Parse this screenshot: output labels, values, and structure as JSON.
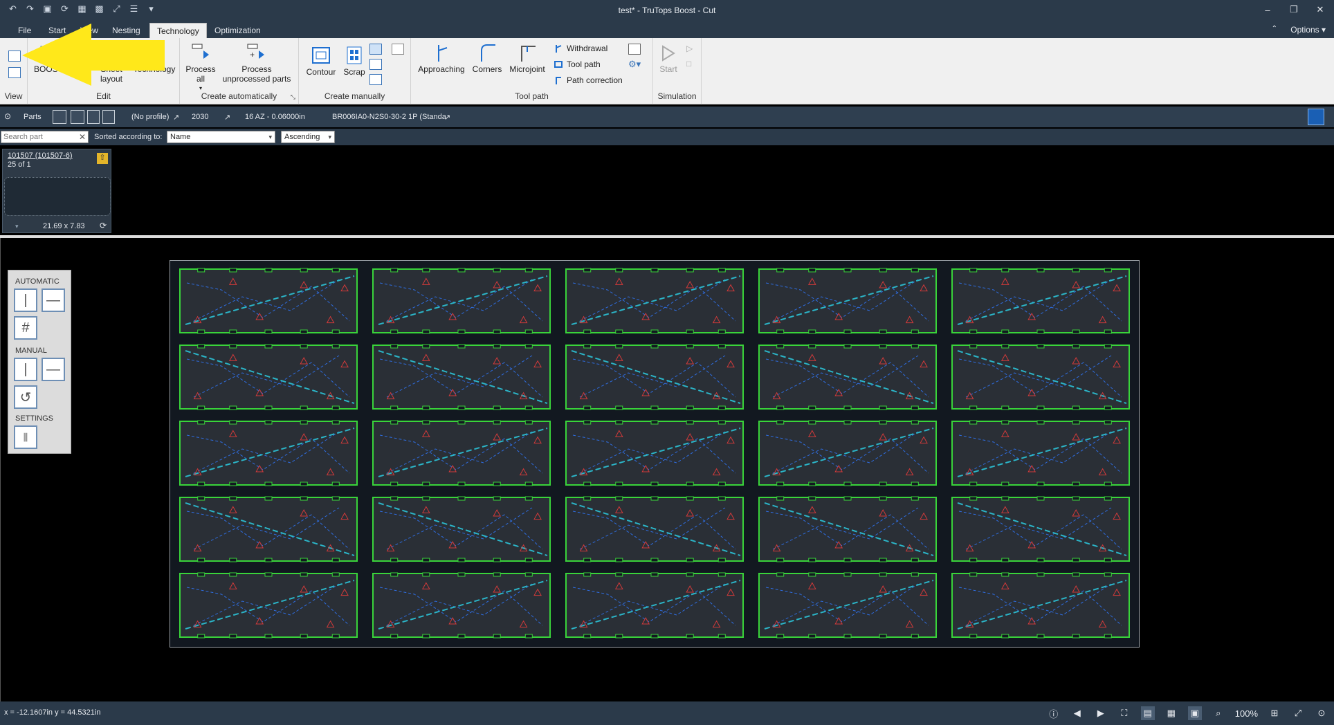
{
  "window": {
    "title": "test* - TruTops Boost - Cut"
  },
  "quick_access": [
    "undo-icon",
    "redo-icon",
    "save-icon",
    "refresh-icon",
    "grid-icon",
    "grid-alt-icon",
    "resize-icon",
    "toolbar-icon"
  ],
  "menu": {
    "tabs": [
      "File",
      "Start",
      "View",
      "Nesting",
      "Technology",
      "Optimization"
    ],
    "active_tab": "Technology",
    "options_label": "Options"
  },
  "ribbon": {
    "view": {
      "group_label": "View"
    },
    "edit": {
      "group_label": "Edit",
      "boost_label": "BOOST",
      "sheet_layout_label": "Sheet layout",
      "technology_label": "Technology"
    },
    "create_auto": {
      "group_label": "Create automatically",
      "process_all_label": "Process all",
      "process_unprocessed_label": "Process unprocessed parts"
    },
    "create_manual": {
      "group_label": "Create manually",
      "contour_label": "Contour",
      "scrap_label": "Scrap"
    },
    "tool_path": {
      "group_label": "Tool path",
      "approaching_label": "Approaching",
      "corners_label": "Corners",
      "microjoint_label": "Microjoint",
      "withdrawal_label": "Withdrawal",
      "tool_path_label": "Tool path",
      "path_correction_label": "Path correction"
    },
    "simulation": {
      "group_label": "Simulation",
      "start_label": "Start"
    }
  },
  "parts_bar": {
    "parts_label": "Parts",
    "profile": "(No profile)",
    "material": "2030",
    "thickness": "16 AZ - 0.06000in",
    "table": "BR006IA0-N2S0-30-2 1P (Standa"
  },
  "search": {
    "placeholder": "Search part",
    "sort_label": "Sorted according to:",
    "sort_by": "Name",
    "sort_order": "Ascending"
  },
  "part_card": {
    "name": "101507 (101507-6)",
    "count": "25 of 1",
    "dims": "21.69 x 7.83"
  },
  "split_panel": {
    "automatic_label": "AUTOMATIC",
    "manual_label": "MANUAL",
    "settings_label": "SETTINGS"
  },
  "sheet": {
    "rows": 5,
    "cols": 5,
    "part_outline_color": "#39d43a",
    "path_color": "#2f6de0",
    "rapid_color": "#2bb5c8",
    "marker_color": "#d23a3a"
  },
  "status": {
    "coords": "x = -12.1607in y = 44.5321in",
    "zoom": "100%"
  }
}
